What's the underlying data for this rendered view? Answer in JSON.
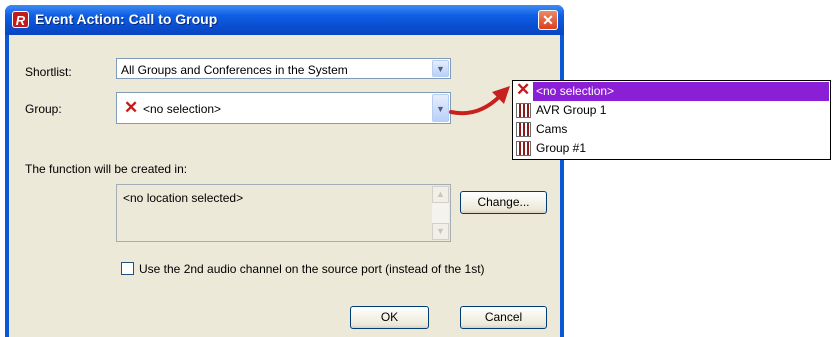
{
  "window": {
    "app_icon": "R",
    "title": "Event Action: Call to Group",
    "close_glyph": "✕"
  },
  "form": {
    "shortlist_label": "Shortlist:",
    "shortlist_value": "All Groups and Conferences in the System",
    "group_label": "Group:",
    "group_value": "<no selection>",
    "function_label": "The function will be created in:",
    "location_value": "<no location selected>",
    "change_button": "Change...",
    "checkbox_label": "Use the 2nd audio channel on the source port (instead of the 1st)",
    "checkbox_checked": false,
    "ok_button": "OK",
    "cancel_button": "Cancel"
  },
  "dropdown": {
    "items": [
      {
        "label": "<no selection>",
        "icon": "red-x-icon",
        "selected": true
      },
      {
        "label": "AVR Group 1",
        "icon": "group-icon",
        "selected": false
      },
      {
        "label": "Cams",
        "icon": "group-icon",
        "selected": false
      },
      {
        "label": "Group #1",
        "icon": "group-icon",
        "selected": false
      }
    ]
  },
  "colors": {
    "title_bar": "#0a4fd0",
    "dialog_face": "#ece9d8",
    "selection": "#8a1fd6",
    "callout_arrow": "#c8201e",
    "red_x": "#c41a1a"
  }
}
